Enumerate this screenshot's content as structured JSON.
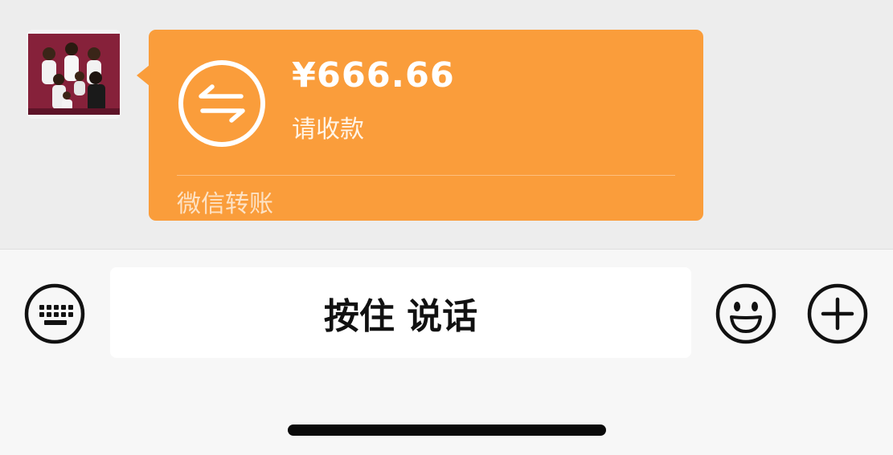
{
  "message": {
    "amount": "¥666.66",
    "status": "请收款",
    "footer_label": "微信转账",
    "bubble_color": "#fa9d3b",
    "icon": "transfer-arrows-icon"
  },
  "avatar": {
    "icon": "family-photo-avatar"
  },
  "input_bar": {
    "talk_label": "按住 说话",
    "left_icon": "keyboard-icon",
    "emoji_icon": "smiley-icon",
    "more_icon": "plus-icon"
  }
}
